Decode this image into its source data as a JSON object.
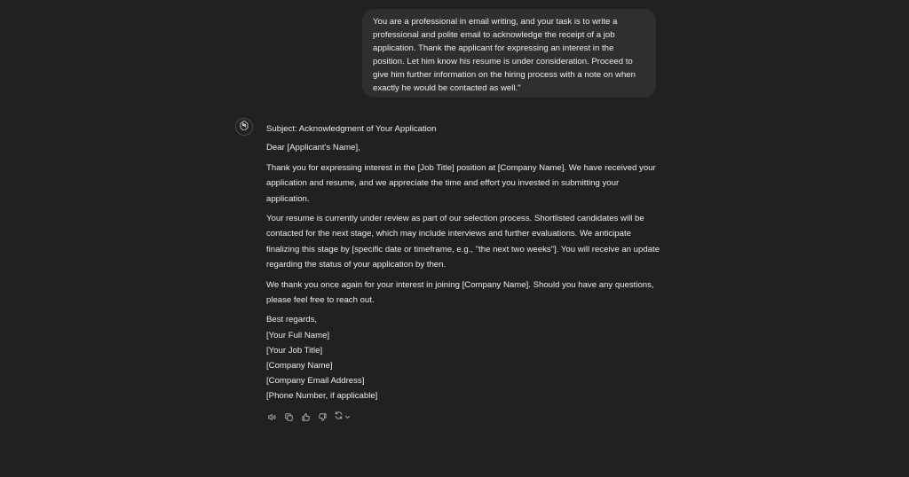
{
  "user_message": {
    "text": "You are a professional in email writing, and your task is to write a professional and polite email to acknowledge the receipt of a job application. Thank the applicant for expressing an interest in the position. Let him know his resume is under consideration. Proceed to give him further information on the hiring process with a note on when exactly he would be contacted as well.\""
  },
  "assistant_message": {
    "subject": "Subject: Acknowledgment of Your Application",
    "greeting": "Dear [Applicant's Name],",
    "paragraph_1": "Thank you for expressing interest in the [Job Title] position at [Company Name]. We have received your application and resume, and we appreciate the time and effort you invested in submitting your application.",
    "paragraph_2": "Your resume is currently under review as part of our selection process. Shortlisted candidates will be contacted for the next stage, which may include interviews and further evaluations. We anticipate finalizing this stage by [specific date or timeframe, e.g., \"the next two weeks\"]. You will receive an update regarding the status of your application by then.",
    "paragraph_3": "We thank you once again for your interest in joining [Company Name]. Should you have any questions, please feel free to reach out.",
    "signoff": [
      "Best regards,",
      "[Your Full Name]",
      "[Your Job Title]",
      "[Company Name]",
      "[Company Email Address]",
      "[Phone Number, if applicable]"
    ]
  },
  "actions": {
    "icons": [
      "speaker-icon",
      "copy-icon",
      "thumbs-up-icon",
      "thumbs-down-icon",
      "regenerate-icon",
      "chevron-down-icon"
    ]
  },
  "colors": {
    "background": "#212121",
    "user_bubble": "#2f2f2f",
    "text": "#ececec",
    "icon": "#a8a8a8"
  }
}
